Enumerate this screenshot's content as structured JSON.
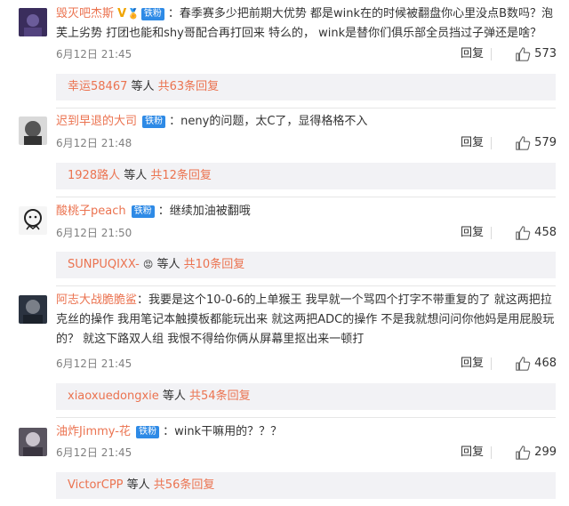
{
  "comments": [
    {
      "username": "毁灭吧杰斯",
      "badge": "铁粉",
      "verified": "V",
      "text_line1": "：春季赛多少把前期大优势 都是wink在的时候被翻盘你心里没点B数吗？泡",
      "text_line2": "芙上劣势 打团也能和shy哥配合再打回来 特么的， wink是替你们俱乐部全员挡过子弹还是啥？",
      "time": "6月12日 21:45",
      "reply_label": "回复",
      "likes": "573",
      "sub_user": "幸运58467",
      "sub_mid": " 等人 ",
      "sub_count": "共63条回复"
    },
    {
      "username": "迟到早退的大司",
      "badge": "铁粉",
      "text_line1": "：neny的问题，太C了，显得格格不入",
      "time": "6月12日 21:48",
      "reply_label": "回复",
      "likes": "579",
      "sub_user": "1928路人",
      "sub_mid": " 等人 ",
      "sub_count": "共12条回复"
    },
    {
      "username": "酸桃子peach",
      "badge": "铁粉",
      "text_line1": "：继续加油被翻哦",
      "time": "6月12日 21:50",
      "reply_label": "回复",
      "likes": "458",
      "sub_user": "SUNPUQIXX-",
      "sub_mid": " 等人 ",
      "sub_count": "共10条回复"
    },
    {
      "username": "阿志大战脆脆鲨",
      "text_line1": "：我要是这个10-0-6的上单猴王 我早就一个骂四个打字不带重复的了 就这两把拉",
      "text_line2": "克丝的操作 我用笔记本触摸板都能玩出来 就这两把ADC的操作 不是我就想问问你他妈是用屁股玩",
      "text_line3": "的？ 就这下路双人组 我恨不得给你俩从屏幕里抠出来一顿打",
      "time": "6月12日 21:45",
      "reply_label": "回复",
      "likes": "468",
      "sub_user": "xiaoxuedongxie",
      "sub_mid": " 等人 ",
      "sub_count": "共54条回复"
    },
    {
      "username": "油炸Jimmy-花",
      "badge": "铁粉",
      "text_line1": "：wink干嘛用的？？？",
      "time": "6月12日 21:45",
      "reply_label": "回复",
      "likes": "299",
      "sub_user": "VictorCPP",
      "sub_mid": " 等人 ",
      "sub_count": "共56条回复"
    }
  ]
}
